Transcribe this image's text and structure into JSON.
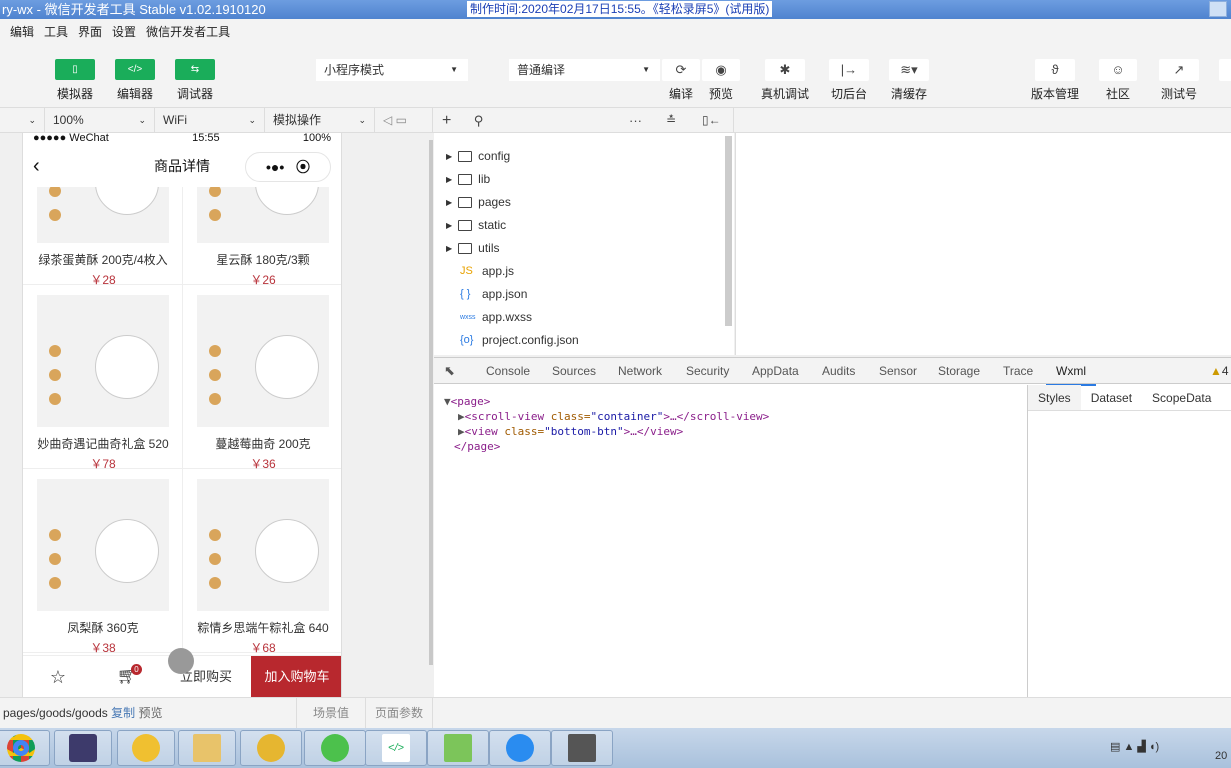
{
  "window": {
    "title": "ry-wx - 微信开发者工具 Stable v1.02.1910120",
    "recorder_overlay": "制作时间:2020年02月17日15:55。《轻松录屏5》(试用版)"
  },
  "menu": [
    "编辑",
    "工具",
    "界面",
    "设置",
    "微信开发者工具"
  ],
  "toolbar": {
    "simulator": "模拟器",
    "editor": "编辑器",
    "debugger": "调试器",
    "mode": "小程序模式",
    "compile_mode": "普通编译",
    "compile": "编译",
    "preview": "预览",
    "remote_debug": "真机调试",
    "background": "切后台",
    "clear_cache": "清缓存",
    "version": "版本管理",
    "community": "社区",
    "test_account": "测试号"
  },
  "subbar": {
    "zoom": "100%",
    "network": "WiFi",
    "operation": "模拟操作"
  },
  "phone": {
    "carrier": "●●●●● WeChat",
    "time": "15:55",
    "battery": "100%",
    "nav_title": "商品详情",
    "capsule_more": "•●•",
    "products": [
      {
        "name": "绿茶蛋黄酥 200克/4枚入",
        "price": "￥28"
      },
      {
        "name": "星云酥 180克/3颗",
        "price": "￥26"
      },
      {
        "name": "妙曲奇遇记曲奇礼盒 520",
        "price": "￥78"
      },
      {
        "name": "蔓越莓曲奇 200克",
        "price": "￥36"
      },
      {
        "name": "凤梨酥 360克",
        "price": "￥38"
      },
      {
        "name": "粽情乡思端午粽礼盒 640",
        "price": "￥68"
      }
    ],
    "cart_badge": "0",
    "buy_now": "立即购买",
    "add_cart": "加入购物车",
    "accent": "#b8282e"
  },
  "files": [
    {
      "type": "folder",
      "name": "config"
    },
    {
      "type": "folder",
      "name": "lib"
    },
    {
      "type": "folder",
      "name": "pages"
    },
    {
      "type": "folder",
      "name": "static"
    },
    {
      "type": "folder",
      "name": "utils"
    },
    {
      "type": "js",
      "icon": "JS",
      "name": "app.js"
    },
    {
      "type": "json",
      "icon": "{ }",
      "name": "app.json"
    },
    {
      "type": "wxss",
      "icon": "wxss",
      "name": "app.wxss"
    },
    {
      "type": "json",
      "icon": "{o}",
      "name": "project.config.json"
    }
  ],
  "devtools": {
    "tabs": [
      "Console",
      "Sources",
      "Network",
      "Security",
      "AppData",
      "Audits",
      "Sensor",
      "Storage",
      "Trace",
      "Wxml"
    ],
    "active": "Wxml",
    "warnings": "4",
    "tree": {
      "page_open": "<page>",
      "scroll": "<scroll-view",
      "scroll_attr": "class=",
      "scroll_val": "\"container\"",
      "scroll_end": ">…</scroll-view>",
      "view": "<view",
      "view_attr": "class=",
      "view_val": "\"bottom-btn\"",
      "view_end": ">…</view>",
      "page_close": "</page>"
    },
    "side_tabs": [
      "Styles",
      "Dataset",
      "ScopeData"
    ]
  },
  "footer": {
    "path": "pages/goods/goods",
    "copy": "复制",
    "preview": "预览",
    "scene": "场景值",
    "params": "页面参数"
  },
  "taskbar": {
    "clock": "20"
  }
}
